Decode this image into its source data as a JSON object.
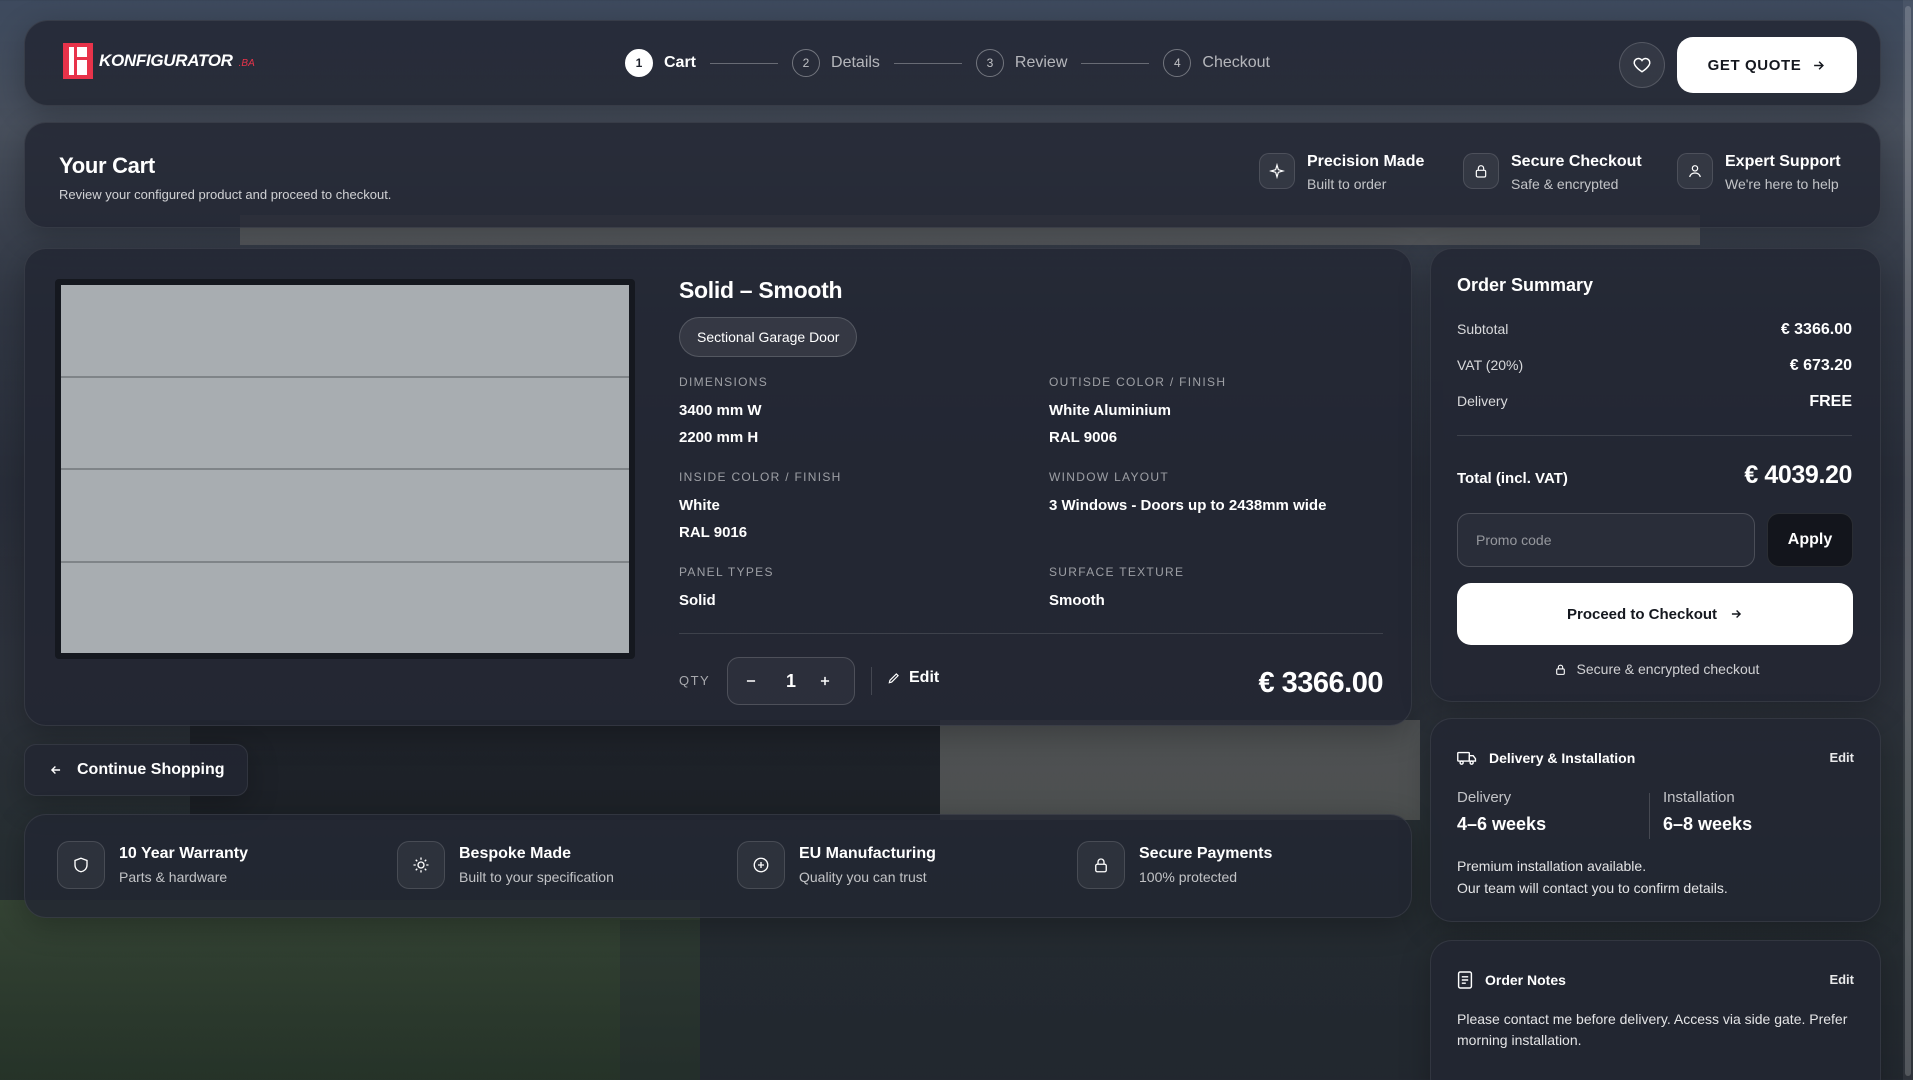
{
  "brand": {
    "name": "KONFIGURATOR",
    "suffix": ".BA"
  },
  "steps": [
    {
      "num": "1",
      "label": "Cart"
    },
    {
      "num": "2",
      "label": "Details"
    },
    {
      "num": "3",
      "label": "Review"
    },
    {
      "num": "4",
      "label": "Checkout"
    }
  ],
  "header": {
    "quote_label": "GET QUOTE"
  },
  "cart": {
    "title": "Your Cart",
    "subtitle": "Review your configured product and proceed to checkout."
  },
  "features": [
    {
      "title": "Precision Made",
      "sub": "Built to order",
      "icon": "sparkle-icon"
    },
    {
      "title": "Secure Checkout",
      "sub": "Safe & encrypted",
      "icon": "lock-icon"
    },
    {
      "title": "Expert Support",
      "sub": "We're here to help",
      "icon": "user-icon"
    }
  ],
  "product": {
    "name": "Solid – Smooth",
    "tag": "Sectional Garage Door",
    "specs": {
      "dimensions": {
        "label": "DIMENSIONS",
        "line1": "3400 mm W",
        "line2": "2200 mm H"
      },
      "outside": {
        "label": "OUTISDE COLOR / FINISH",
        "line1": "White Aluminium",
        "line2": "RAL 9006"
      },
      "inside": {
        "label": "INSIDE COLOR / FINISH",
        "line1": "White",
        "line2": "RAL 9016"
      },
      "window": {
        "label": "WINDOW LAYOUT",
        "line1": "3 Windows - Doors up to 2438mm wide"
      },
      "panel": {
        "label": "PANEL TYPES",
        "line1": "Solid"
      },
      "surface": {
        "label": "SURFACE TEXTURE",
        "line1": "Smooth"
      }
    },
    "qty_label": "QTY",
    "qty": "1",
    "edit_label": "Edit",
    "price": "€ 3366.00"
  },
  "continue_label": "Continue Shopping",
  "guarantees": [
    {
      "title": "10 Year Warranty",
      "sub": "Parts & hardware"
    },
    {
      "title": "Bespoke Made",
      "sub": "Built to your specification"
    },
    {
      "title": "EU Manufacturing",
      "sub": "Quality you can trust"
    },
    {
      "title": "Secure Payments",
      "sub": "100% protected"
    }
  ],
  "summary": {
    "title": "Order Summary",
    "subtotal_label": "Subtotal",
    "subtotal": "€ 3366.00",
    "vat_label": "VAT (20%)",
    "vat": "€ 673.20",
    "delivery_label": "Delivery",
    "delivery": "FREE",
    "total_label": "Total (incl. VAT)",
    "total": "€ 4039.20",
    "promo_placeholder": "Promo code",
    "apply_label": "Apply",
    "checkout_label": "Proceed to Checkout",
    "secure_note": "Secure & encrypted checkout"
  },
  "delivery": {
    "title": "Delivery & Installation",
    "edit_label": "Edit",
    "delivery_label": "Delivery",
    "delivery_value": "4–6 weeks",
    "install_label": "Installation",
    "install_value": "6–8 weeks",
    "note1": "Premium installation available.",
    "note2": "Our team will contact you to confirm details."
  },
  "notes": {
    "title": "Order Notes",
    "edit_label": "Edit",
    "text": "Please contact me before delivery. Access via side gate. Prefer morning installation."
  },
  "colors": {
    "accent_red": "#e8334a",
    "panel_bg": "#222632",
    "door_color": "#a8adb1"
  }
}
